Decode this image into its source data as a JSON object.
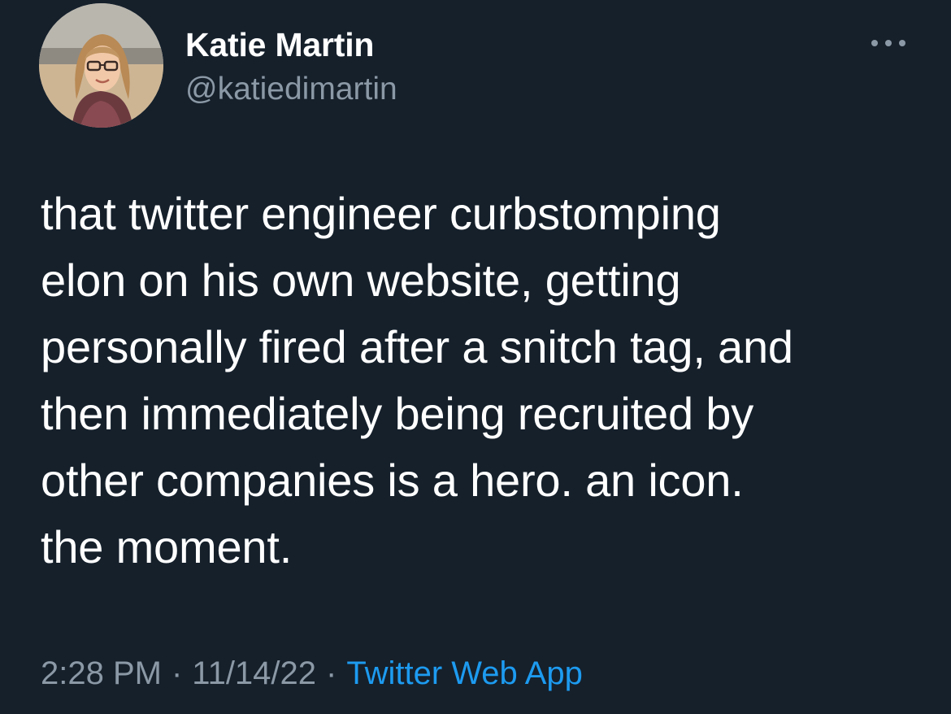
{
  "author": {
    "display_name": "Katie Martin",
    "handle": "@katiedimartin"
  },
  "tweet": {
    "lines": [
      "that twitter engineer curbstomping",
      "elon on his own website, getting",
      "personally fired after a snitch tag, and",
      "then immediately being recruited by",
      "other companies is a hero. an icon.",
      "the moment."
    ]
  },
  "meta": {
    "time": "2:28 PM",
    "separator": "·",
    "date": "11/14/22",
    "source": "Twitter Web App"
  },
  "icons": {
    "more": "more-options-icon"
  },
  "colors": {
    "background": "#15202b",
    "primary_text": "#ffffff",
    "secondary_text": "#8b98a5",
    "link": "#1d9bf0"
  }
}
